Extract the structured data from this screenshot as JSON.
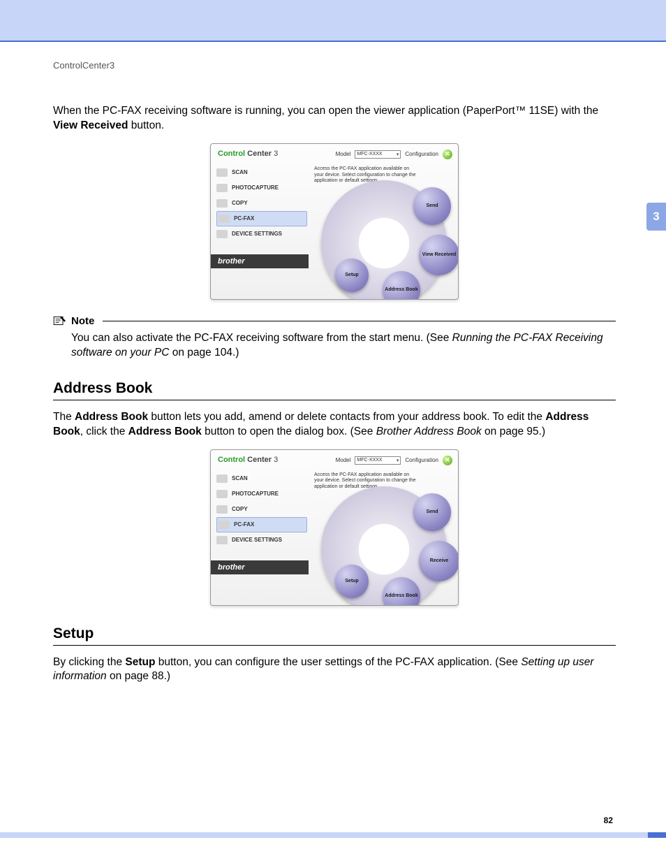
{
  "header": {
    "breadcrumb": "ControlCenter3"
  },
  "chapter_tab": "3",
  "page_number": "82",
  "intro": {
    "pre": "When the PC-FAX receiving software is running, you can open the viewer application (PaperPort™ 11SE) with the ",
    "bold": "View Received",
    "post": " button."
  },
  "note": {
    "label": "Note",
    "body_pre": "You can also activate the PC-FAX receiving software from the start menu. (See ",
    "body_italic": "Running the PC-FAX Receiving software on your PC",
    "body_post": " on page 104.)"
  },
  "section1": {
    "title": "Address Book",
    "p1_a": "The ",
    "p1_b": "Address Book",
    "p1_c": " button lets you add, amend or delete contacts from your address book. To edit the ",
    "p1_d": "Address Book",
    "p1_e": ", click the ",
    "p1_f": "Address Book",
    "p1_g": " button to open the dialog box. (See ",
    "p1_h": "Brother Address Book",
    "p1_i": " on page 95.)"
  },
  "section2": {
    "title": "Setup",
    "p1_a": "By clicking the ",
    "p1_b": "Setup",
    "p1_c": " button, you can configure the user settings of the PC-FAX application. (See ",
    "p1_d": "Setting up user information",
    "p1_e": " on page 88.)"
  },
  "app": {
    "title_bold1": "Control",
    "title_bold2": " Center",
    "title_num": " 3",
    "model_label": "Model",
    "model_value": "MFC-XXXX",
    "config_label": "Configuration",
    "desc": "Access the PC-FAX application available on your device. Select configuration to change the application or default settings.",
    "brand": "brother",
    "side": {
      "scan": "SCAN",
      "photo": "PHOTOCAPTURE",
      "copy": "COPY",
      "pcfax": "PC-FAX",
      "device": "DEVICE SETTINGS"
    },
    "orbs1": {
      "send": "Send",
      "view": "View Received",
      "ab": "Address Book",
      "setup": "Setup"
    },
    "orbs2": {
      "send": "Send",
      "recv": "Receive",
      "ab": "Address Book",
      "setup": "Setup"
    }
  }
}
